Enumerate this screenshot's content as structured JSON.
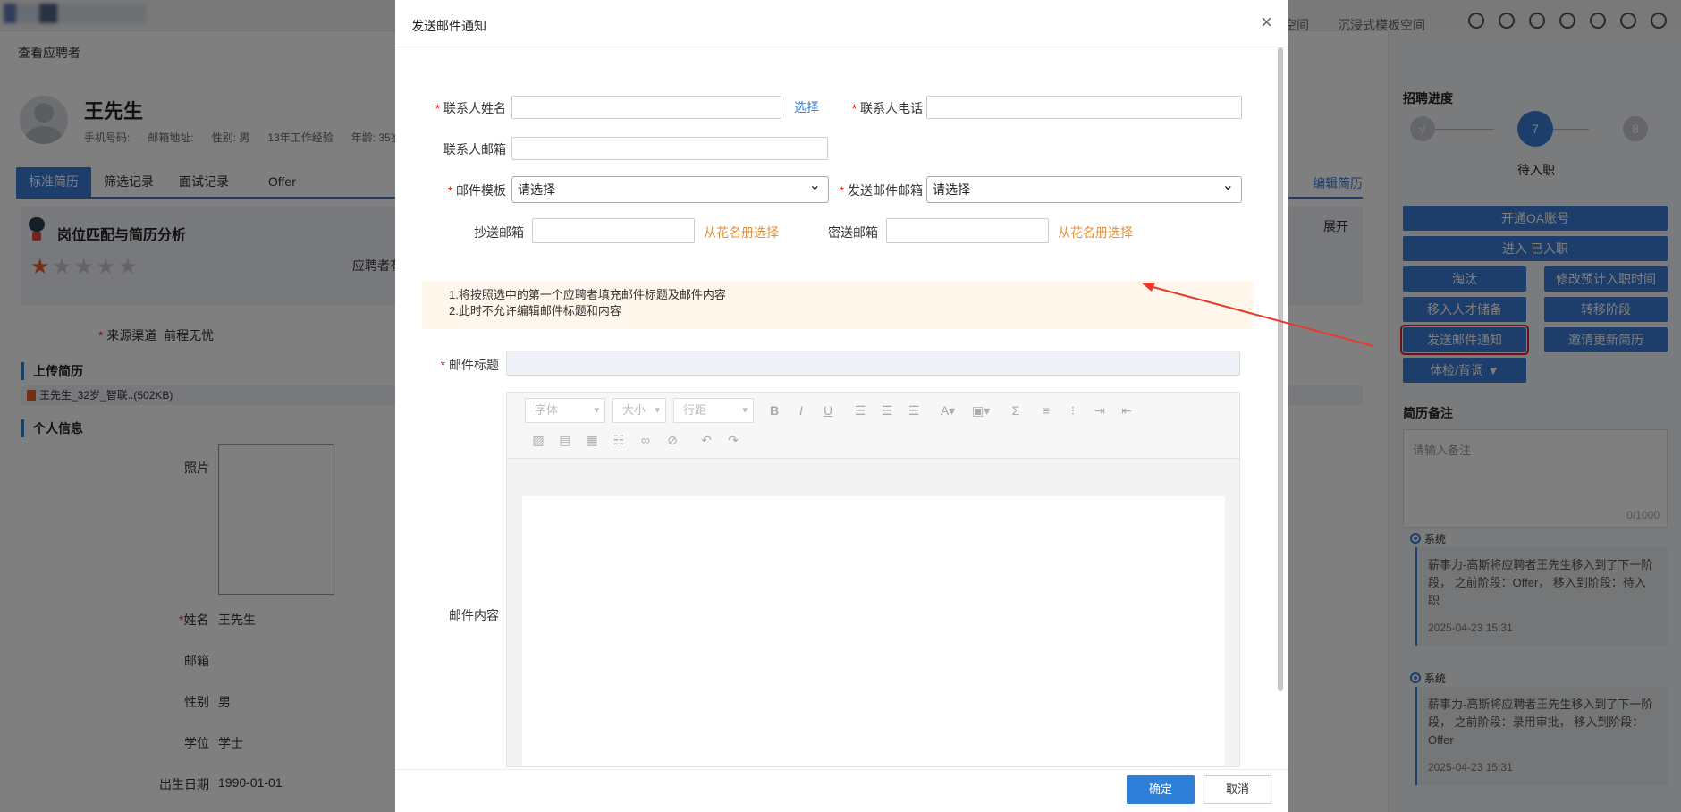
{
  "topbar": {
    "link1": "空间",
    "link2": "沉浸式模板空间"
  },
  "bg": {
    "title": "查看应聘者",
    "candidate": {
      "name": "王先生",
      "phone_label": "手机号码:",
      "email_label": "邮箱地址:",
      "gender": "性别: 男",
      "experience": "13年工作经验",
      "age": "年龄: 35岁"
    },
    "tabs": [
      "标准简历",
      "筛选记录",
      "面试记录",
      "Offer"
    ],
    "edit_resume": "编辑简历",
    "match_title": "岗位匹配与简历分析",
    "expand": "展开",
    "applicant_partial": "应聘者有",
    "source_label": "来源渠道",
    "source_value": "前程无忧",
    "upload_title": "上传简历",
    "file_name": "王先生_32岁_智联..(502KB)",
    "personal_title": "个人信息",
    "photo_label": "照片",
    "name_label": "姓名",
    "name_value": "王先生",
    "email_label": "邮箱",
    "gender_label": "性别",
    "gender_value": "男",
    "degree_label": "学位",
    "degree_value": "学士",
    "birth_label": "出生日期",
    "birth_value": "1990-01-01"
  },
  "right_panel": {
    "progress_title": "招聘进度",
    "steps": [
      {
        "label": "√"
      },
      {
        "label": "7"
      },
      {
        "label": "8"
      }
    ],
    "current_stage": "待入职",
    "buttons": {
      "open_oa": "开通OA账号",
      "enter_hired": "进入 已入职",
      "eliminate": "淘汰",
      "modify_date": "修改预计入职时间",
      "talent_pool": "移入人才储备",
      "transfer": "转移阶段",
      "send_email": "发送邮件通知",
      "invite_update": "邀请更新简历",
      "physical": "体检/背调 ▼"
    },
    "notes_title": "简历备注",
    "notes_placeholder": "请输入备注",
    "notes_count": "0/1000",
    "logs": [
      {
        "who": "系统",
        "text": "薪事力-高斯将应聘者王先生移入到了下一阶段， 之前阶段：Offer， 移入到阶段：待入职",
        "time": "2025-04-23 15:31"
      },
      {
        "who": "系统",
        "text": "薪事力-高斯将应聘者王先生移入到了下一阶段， 之前阶段：录用审批， 移入到阶段：Offer",
        "time": "2025-04-23 15:31"
      }
    ]
  },
  "modal": {
    "title": "发送邮件通知",
    "close": "×",
    "contact_name_label": "联系人姓名",
    "contact_name_value": "",
    "select_link": "选择",
    "contact_phone_label": "联系人电话",
    "contact_phone_value": "",
    "contact_email_label": "联系人邮箱",
    "contact_email_value": "",
    "template_label": "邮件模板",
    "template_value": "请选择",
    "sender_label": "发送邮件邮箱",
    "sender_value": "请选择",
    "cc_label": "抄送邮箱",
    "cc_link": "从花名册选择",
    "bcc_label": "密送邮箱",
    "bcc_link": "从花名册选择",
    "tips": [
      "1.将按照选中的第一个应聘者填充邮件标题及邮件内容",
      "2.此时不允许编辑邮件标题和内容"
    ],
    "subject_label": "邮件标题",
    "content_label": "邮件内容",
    "editor": {
      "font": "字体",
      "size": "大小",
      "line_height": "行距"
    },
    "ok": "确定",
    "cancel": "取消"
  },
  "colors": {
    "primary": "#3a7bd5",
    "required": "#e02020",
    "link_orange": "#e0903a",
    "tip_bg": "#fff7eb",
    "arrow": "#e83a2a"
  }
}
